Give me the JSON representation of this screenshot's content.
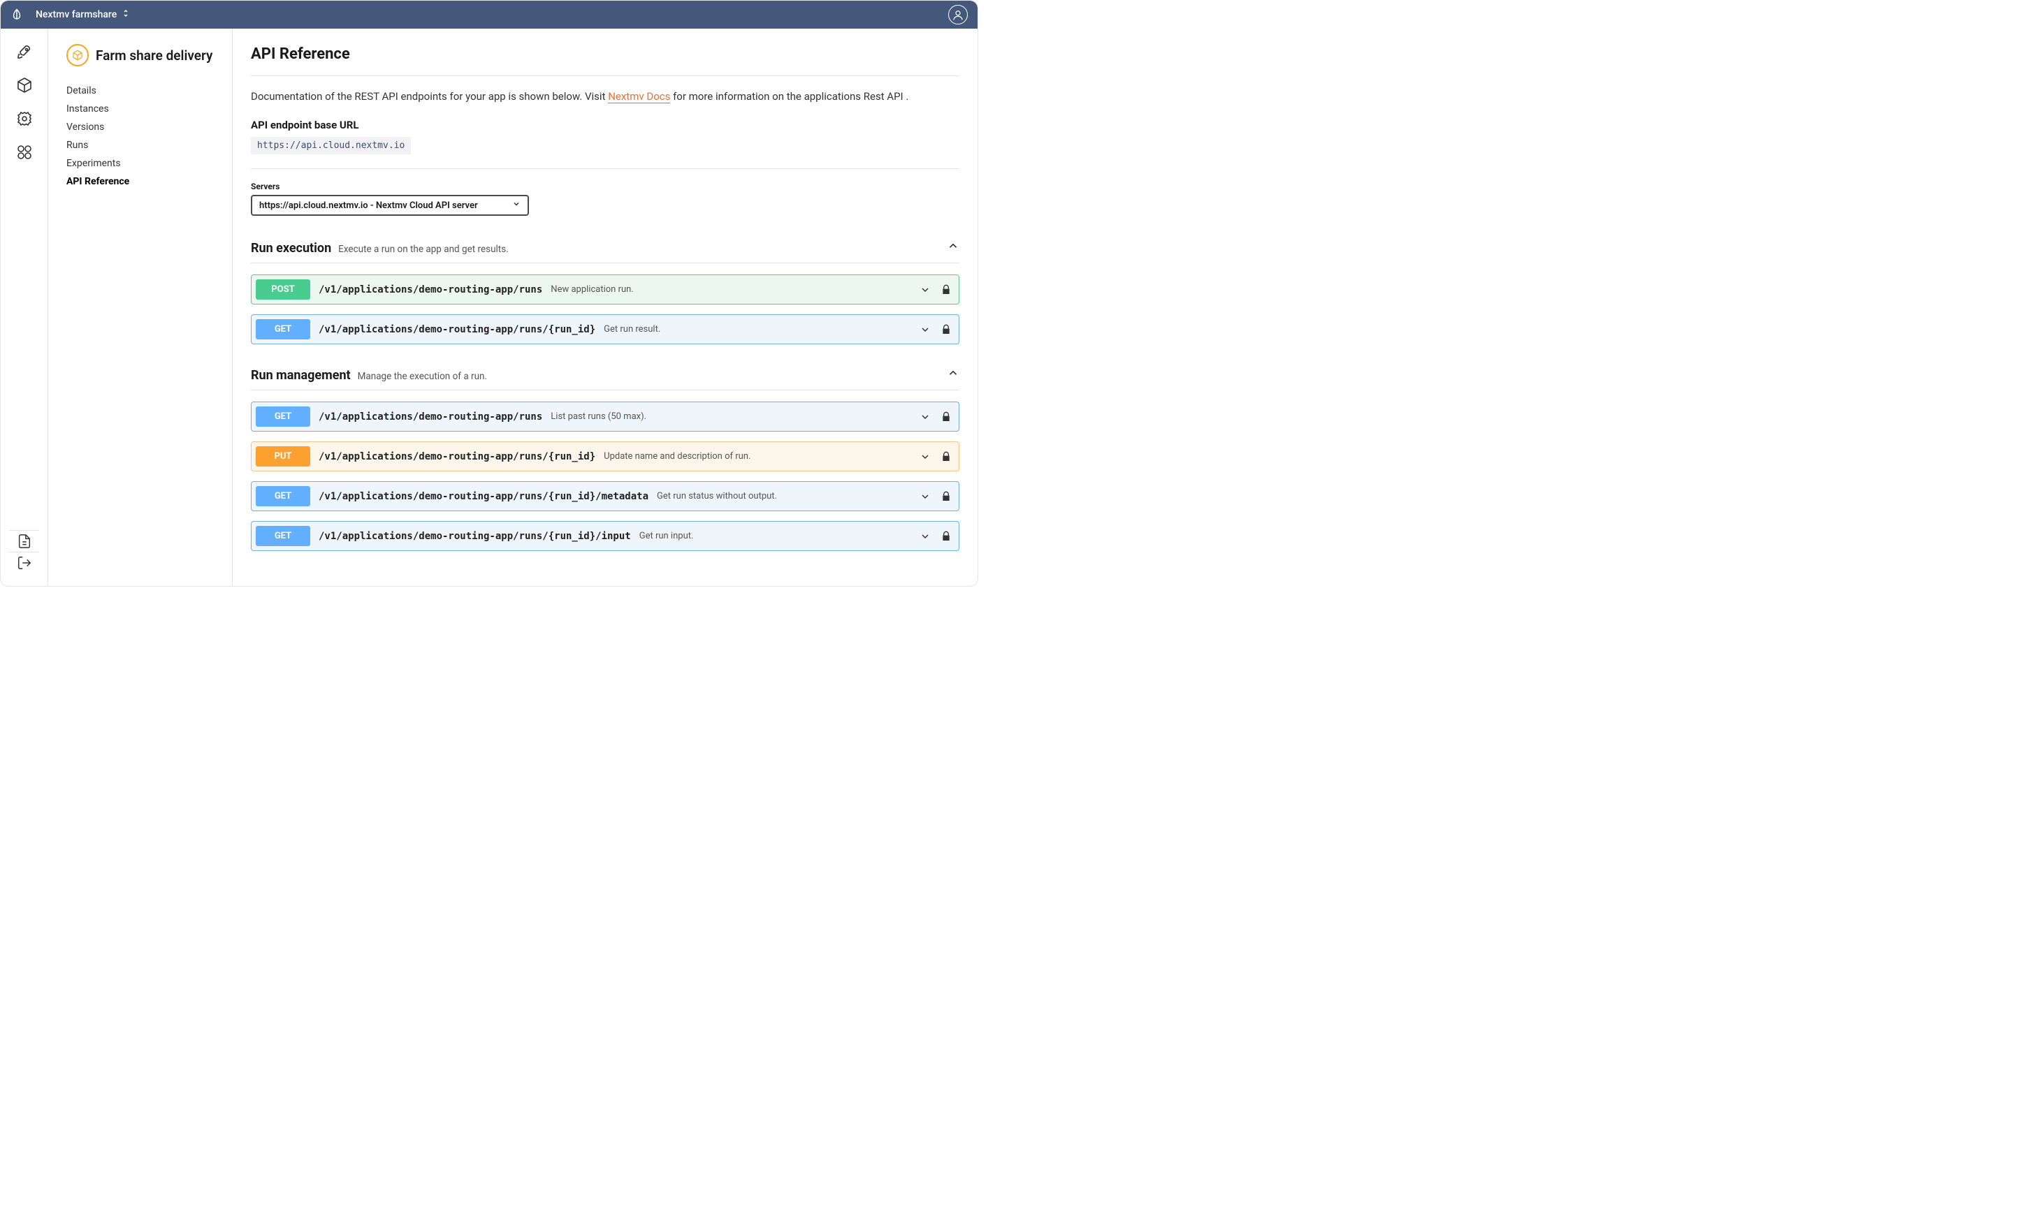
{
  "topbar": {
    "org_name": "Nextmv farmshare"
  },
  "sidebar": {
    "app_name": "Farm share delivery",
    "items": [
      {
        "label": "Details"
      },
      {
        "label": "Instances"
      },
      {
        "label": "Versions"
      },
      {
        "label": "Runs"
      },
      {
        "label": "Experiments"
      },
      {
        "label": "API Reference"
      }
    ]
  },
  "main": {
    "title": "API Reference",
    "desc1": "Documentation of the REST API endpoints for your app is shown below. Visit ",
    "docs_link": "Nextmv Docs",
    "desc2": " for more information on the applications Rest API .",
    "base_url_label": "API endpoint base URL",
    "base_url": "https://api.cloud.nextmv.io",
    "servers_label": "Servers",
    "server_selected": "https://api.cloud.nextmv.io - Nextmv Cloud API server",
    "sections": [
      {
        "title": "Run execution",
        "sub": "Execute a run on the app and get results.",
        "endpoints": [
          {
            "method": "POST",
            "kind": "post",
            "path": "/v1/applications/demo-routing-app/runs",
            "desc": "New application run."
          },
          {
            "method": "GET",
            "kind": "get",
            "path": "/v1/applications/demo-routing-app/runs/{run_id}",
            "desc": "Get run result."
          }
        ]
      },
      {
        "title": "Run management",
        "sub": "Manage the execution of a run.",
        "endpoints": [
          {
            "method": "GET",
            "kind": "get",
            "path": "/v1/applications/demo-routing-app/runs",
            "desc": "List past runs (50 max)."
          },
          {
            "method": "PUT",
            "kind": "put",
            "path": "/v1/applications/demo-routing-app/runs/{run_id}",
            "desc": "Update name and description of run."
          },
          {
            "method": "GET",
            "kind": "get",
            "path": "/v1/applications/demo-routing-app/runs/{run_id}/metadata",
            "desc": "Get run status without output."
          },
          {
            "method": "GET",
            "kind": "get",
            "path": "/v1/applications/demo-routing-app/runs/{run_id}/input",
            "desc": "Get run input."
          }
        ]
      }
    ]
  }
}
